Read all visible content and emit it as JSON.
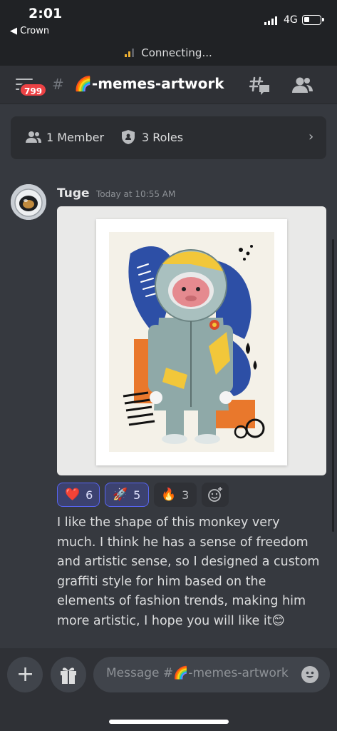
{
  "status": {
    "time": "2:01",
    "back_app": "◀ Crown",
    "network": "4G"
  },
  "connection": {
    "text": "Connecting..."
  },
  "header": {
    "badge": "799",
    "channel_name": "🌈-memes-artwork"
  },
  "info": {
    "members": "1 Member",
    "roles": "3 Roles"
  },
  "message": {
    "author": "Tuge",
    "timestamp": "Today at 10:55 AM",
    "text": "I like the shape of this monkey very much. I think he has a sense of freedom and artistic sense, so I designed a custom graffiti style for him based on the elements of fashion trends, making him more artistic, I hope you will like it😊",
    "reactions": [
      {
        "emoji": "❤️",
        "count": "6",
        "mine": true
      },
      {
        "emoji": "🚀",
        "count": "5",
        "mine": true
      },
      {
        "emoji": "🔥",
        "count": "3",
        "mine": false
      }
    ]
  },
  "composer": {
    "placeholder": "Message #🌈-memes-artwork"
  },
  "colors": {
    "background": "#36393f",
    "header": "#2f3136",
    "accent": "#5865f2",
    "badge": "#ed4245"
  }
}
